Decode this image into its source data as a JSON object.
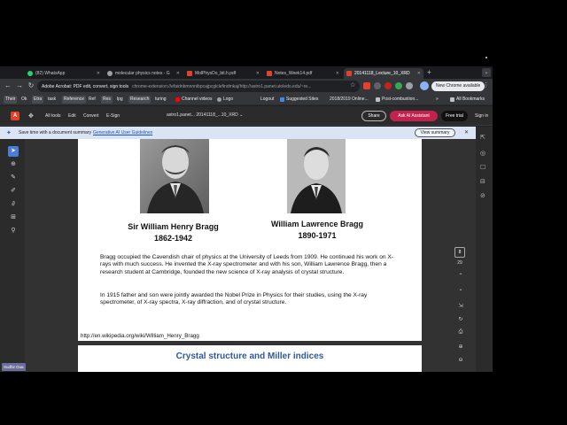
{
  "tabs": [
    {
      "label": "(82) WhatsApp",
      "color": "#25d366",
      "active": false
    },
    {
      "label": "molecular physics notes - G",
      "color": "#9aa0a6",
      "active": false
    },
    {
      "label": "MolPhysDo_bit.h.pdf",
      "color": "#e3412b",
      "active": false
    },
    {
      "label": "Notes_Week14.pdf",
      "color": "#e3412b",
      "active": false
    },
    {
      "label": "20141118_Lecture_10_XRD",
      "color": "#e3412b",
      "active": true
    }
  ],
  "new_tab": "+",
  "omnibox": {
    "origin": "Adobe Acrobat: PDF edit, convert, sign tools",
    "url": "chrome-extension://efaidnbmnnnibpcajpcglclefindmkaj/http://astro1.panet.utoledo.edu/~re..."
  },
  "update_chrome": "New Chrome available",
  "bookmarks": [
    {
      "label": "Their",
      "chip": true
    },
    {
      "label": "Ok",
      "chip": false
    },
    {
      "label": "Etra",
      "chip": true
    },
    {
      "label": "task",
      "chip": false
    },
    {
      "label": "Reference",
      "chip": true
    },
    {
      "label": "Ref",
      "chip": false
    },
    {
      "label": "Res",
      "chip": true
    },
    {
      "label": "lpg",
      "chip": false
    },
    {
      "label": "Research",
      "chip": true
    },
    {
      "label": "turing",
      "chip": false
    },
    {
      "label": "Channel videos",
      "chip": false
    },
    {
      "label": "Logo",
      "chip": false
    },
    {
      "label": "Logout",
      "chip": false
    },
    {
      "label": "Suggested Sites",
      "chip": false
    },
    {
      "label": "2018/2019 Online...",
      "chip": false
    },
    {
      "label": "Post-combustion...",
      "chip": false
    },
    {
      "label": "»",
      "chip": false
    },
    {
      "label": "All Bookmarks",
      "chip": false
    }
  ],
  "acrobat": {
    "menus": [
      "All tools",
      "Edit",
      "Convert",
      "E-Sign"
    ],
    "file": "astro1.panet...   20141118_...10_XRD  ⌄",
    "share": "Share",
    "ai": "Ask AI Assistant",
    "trial": "Free trial",
    "signin": "Sign in"
  },
  "banner": {
    "text": "Save time with a document summary",
    "link": "Generative AI User Guidelines",
    "button": "View summary"
  },
  "slide": {
    "person1_name": "Sir William Henry Bragg",
    "person1_years": "1862-1942",
    "person2_name": "William Lawrence Bragg",
    "person2_years": "1890-1971",
    "para1": "Bragg occupied the Cavendish chair of physics at the University of Leeds from 1909. He continued his work on X-rays with much success. He invented the X-ray spectrometer and with his son, William Lawrence Bragg, then a research student at Cambridge, founded the new science of X-ray analysis of crystal structure.",
    "para2": "In 1915 father and son were jointly awarded the Nobel Prize in Physics for their studies, using the X-ray spectrometer, of X-ray spectra, X-ray diffraction, and of crystal structure.",
    "url": "http://en.wikipedia.org/wiki/William_Henry_Bragg"
  },
  "slide2_title": "Crystal structure and Miller indices",
  "page_nav": {
    "current": "8",
    "total": "29"
  },
  "presenter": "Sudhir Dua"
}
